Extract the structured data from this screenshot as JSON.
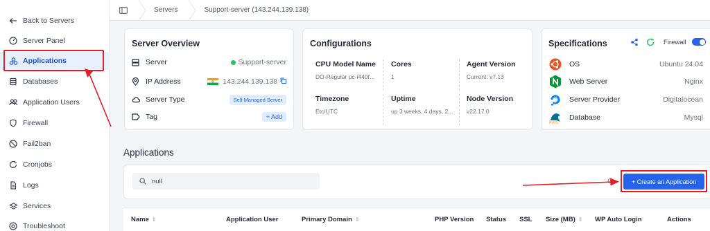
{
  "sidebar": {
    "items": [
      {
        "label": "Back to Servers",
        "icon": "arrow-left-icon"
      },
      {
        "label": "Server Panel",
        "icon": "gauge-icon"
      },
      {
        "label": "Applications",
        "icon": "applications-icon",
        "active": true
      },
      {
        "label": "Databases",
        "icon": "database-icon"
      },
      {
        "label": "Application Users",
        "icon": "users-icon"
      },
      {
        "label": "Firewall",
        "icon": "shield-icon"
      },
      {
        "label": "Fail2ban",
        "icon": "ban-icon"
      },
      {
        "label": "Cronjobs",
        "icon": "refresh-icon"
      },
      {
        "label": "Logs",
        "icon": "file-icon"
      },
      {
        "label": "Services",
        "icon": "services-icon"
      },
      {
        "label": "Troubleshoot",
        "icon": "wrench-icon"
      }
    ]
  },
  "breadcrumb": {
    "items": [
      "Servers",
      "Support-server (143.244.139.138)"
    ]
  },
  "overview": {
    "title": "Server Overview",
    "server_label": "Server",
    "server_value": "Support-server",
    "ip_label": "IP Address",
    "ip_value": "143.244.139.138",
    "type_label": "Server Type",
    "type_value": "Self Managed Server",
    "tag_label": "Tag",
    "tag_add": "+ Add"
  },
  "configurations": {
    "title": "Configurations",
    "cells": [
      {
        "key": "CPU Model Name",
        "value": "DO-Regular pc-i440f..."
      },
      {
        "key": "Cores",
        "value": "1"
      },
      {
        "key": "Agent Version",
        "value": "Current: v7.13"
      },
      {
        "key": "Timezone",
        "value": "Etc/UTC"
      },
      {
        "key": "Uptime",
        "value": "up 3 weeks, 4 days, 2..."
      },
      {
        "key": "Node Version",
        "value": "v22.17.0"
      }
    ]
  },
  "specifications": {
    "title": "Specifications",
    "firewall_label": "Firewall",
    "firewall_on": true,
    "rows": [
      {
        "key": "OS",
        "value": "Ubuntu 24.04",
        "icon": "ubuntu-icon"
      },
      {
        "key": "Web Server",
        "value": "Nginx",
        "icon": "nginx-icon"
      },
      {
        "key": "Server Provider",
        "value": "Digitalocean",
        "icon": "digitalocean-icon"
      },
      {
        "key": "Database",
        "value": "Mysql",
        "icon": "mysql-icon"
      }
    ]
  },
  "applications": {
    "title": "Applications",
    "search_value": "null",
    "create_label": "+ Create an Application",
    "columns": [
      "Name",
      "Application User",
      "Primary Domain",
      "PHP Version",
      "Status",
      "SSL",
      "Size (MB)",
      "WP Auto Login",
      "Actions"
    ]
  },
  "colors": {
    "accent": "#2563eb",
    "highlight": "#e11d2a",
    "online": "#22c55e"
  }
}
